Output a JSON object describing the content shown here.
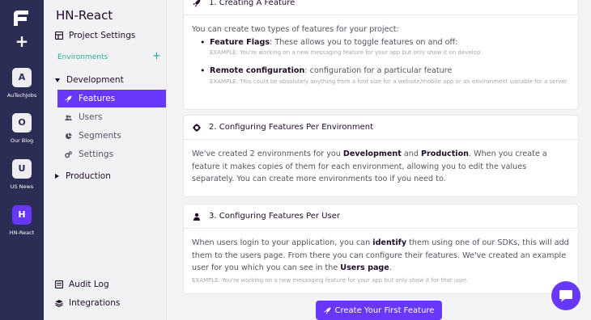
{
  "rail": {
    "projects": [
      {
        "letter": "A",
        "label": "AuTechJobs"
      },
      {
        "letter": "O",
        "label": "Our Blog"
      },
      {
        "letter": "U",
        "label": "US News"
      },
      {
        "letter": "H",
        "label": "HN-React"
      }
    ]
  },
  "sidebar": {
    "title": "HN-React",
    "project_settings": "Project Settings",
    "environments_header": "Environments",
    "environments_add": "+",
    "env_development": "Development",
    "sub_items": [
      "Features",
      "Users",
      "Segments",
      "Settings"
    ],
    "env_production": "Production",
    "audit_log": "Audit Log",
    "integrations": "Integrations"
  },
  "cards": {
    "c1": {
      "title": "1. Creating A Feature",
      "intro": "You can create two types of features for your project:",
      "item1_bold": "Feature Flags",
      "item1_text": ": These allows you to toggle features on and off:",
      "item1_example": "EXAMPLE: You're working on a new messaging feature for your app but only show it on develop.",
      "item2_bold": "Remote configuration",
      "item2_text": ": configuration for a particular feature",
      "item2_example": "EXAMPLE: This could be absolutely anything from a font size for a website/mobile app or an environment variable for a server"
    },
    "c2": {
      "title": "2. Configuring Features Per Environment",
      "t1": "We've created 2 environments for you ",
      "b1": "Development",
      "t2": " and ",
      "b2": "Production",
      "t3": ". When you create a feature it makes copies of them for each environment, allowing you to edit the values separately. You can create more environments too if you need to."
    },
    "c3": {
      "title": "3. Configuring Features Per User",
      "t1": "When users login to your application, you can ",
      "b1": "identify",
      "t2": " them using one of our SDKs, this will add them to the users page. From there you can configure their features. We've created an example user for you which you can see in the ",
      "b2": "Users page",
      "t3": ".",
      "example": "EXAMPLE: You're working on a new messaging feature for your app but only show it for that user."
    }
  },
  "cta_label": "Create Your First Feature",
  "colors": {
    "rail": "#2b2d54",
    "accent": "#6837fc",
    "env_header": "#27ab95"
  }
}
